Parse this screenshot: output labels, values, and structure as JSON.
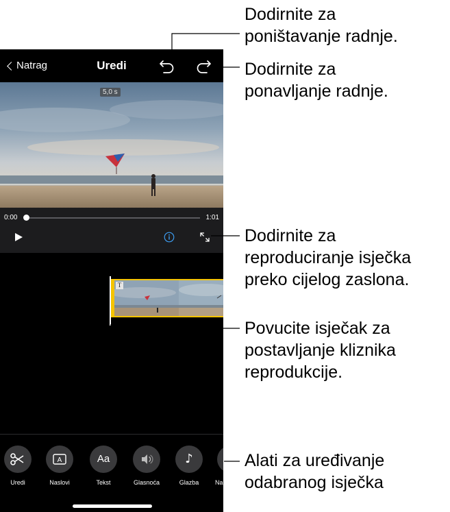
{
  "nav": {
    "back_label": "Natrag",
    "title": "Uredi"
  },
  "viewer": {
    "duration": "5,0 s"
  },
  "scrubber": {
    "time_start": "0:00",
    "time_end": "1:01",
    "progress": 0.0
  },
  "toolbar": {
    "items": [
      {
        "label": "Uredi",
        "icon": "scissors-icon"
      },
      {
        "label": "Naslovi",
        "icon": "titles-icon"
      },
      {
        "label": "Tekst",
        "icon": "text-icon",
        "glyph": "Aa"
      },
      {
        "label": "Glasnoća",
        "icon": "speaker-icon"
      },
      {
        "label": "Glazba",
        "icon": "music-note-icon",
        "glyph": "♪"
      },
      {
        "label": "Nahsi",
        "icon": "more-icon"
      }
    ]
  },
  "callouts": {
    "undo": [
      "Dodirnite za",
      "poništavanje radnje."
    ],
    "redo": [
      "Dodirnite za",
      "ponavljanje radnje."
    ],
    "fullscreen": [
      "Dodirnite za",
      "reproduciranje isječka",
      "preko cijelog zaslona."
    ],
    "clip": [
      "Povucite isječak za",
      "postavljanje kliznika",
      "reprodukcije."
    ],
    "tools": [
      "Alati za uređivanje",
      "odabranog isječka"
    ]
  },
  "colors": {
    "clip_border": "#f5c400",
    "info_accent": "#3d9df2",
    "background": "#000000"
  }
}
